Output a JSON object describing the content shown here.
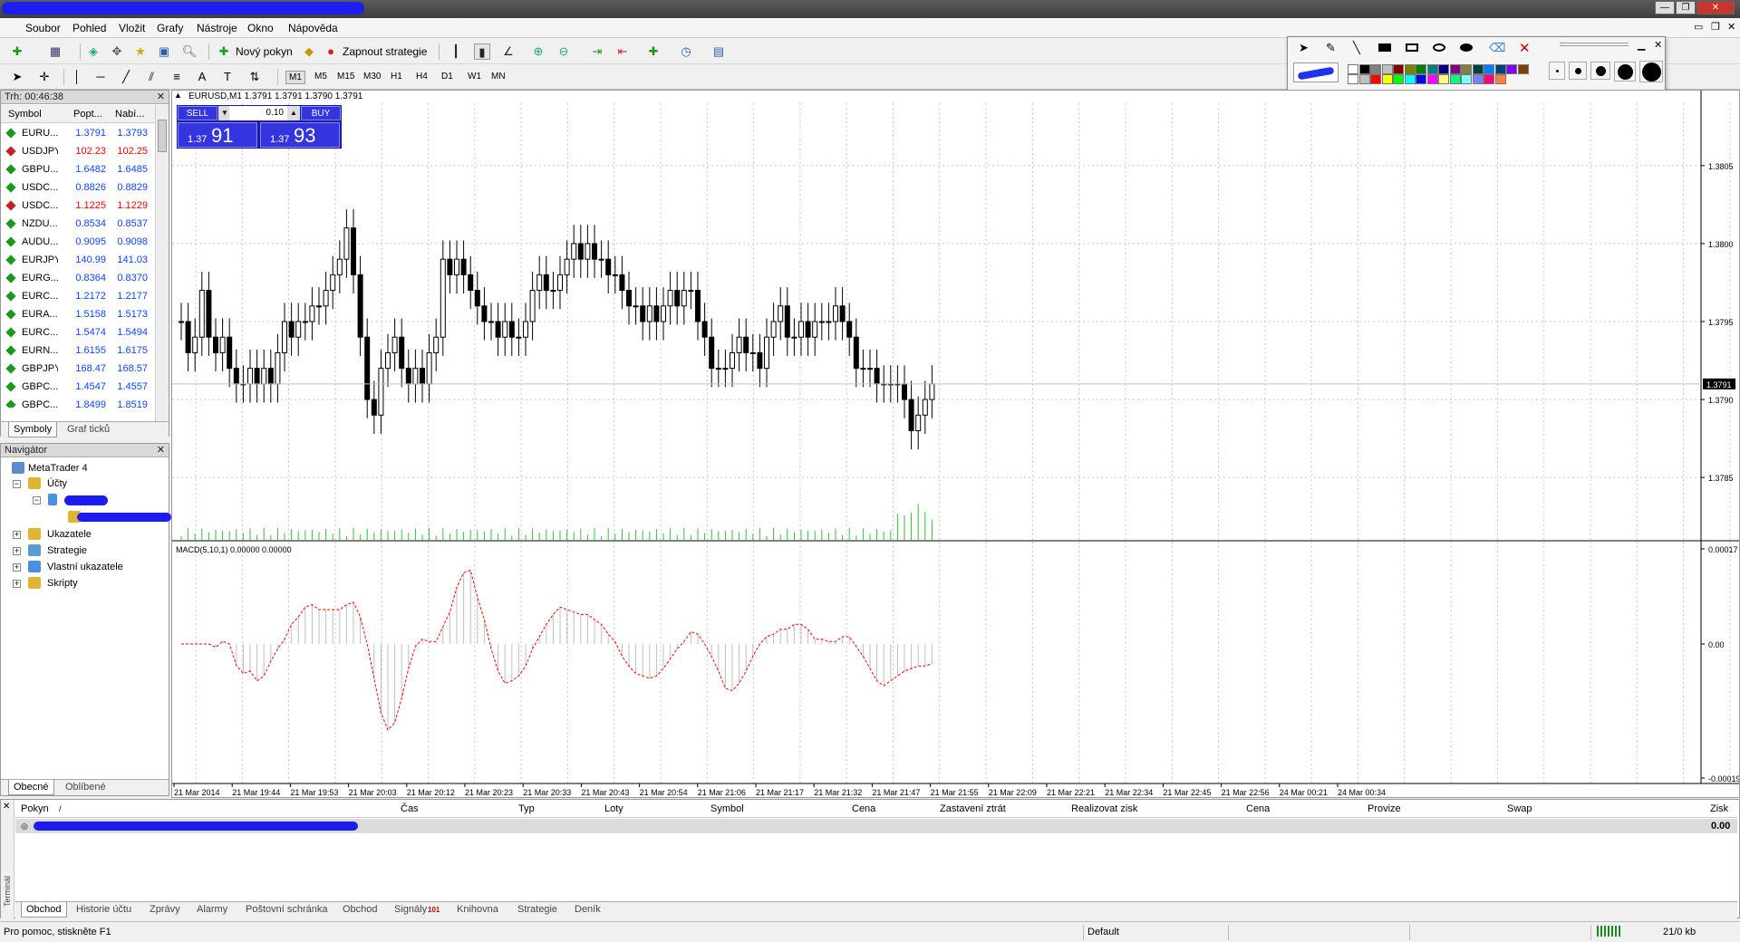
{
  "window": {
    "close_glyph": "✕",
    "restore_glyph": "❐",
    "min_glyph": "—"
  },
  "menu": {
    "items": [
      "Soubor",
      "Pohled",
      "Vložit",
      "Grafy",
      "Nástroje",
      "Okno",
      "Nápověda"
    ]
  },
  "toolbar": {
    "new_order_label": "Nový pokyn",
    "autotrade_label": "Zapnout strategie",
    "timeframes": [
      "M1",
      "M5",
      "M15",
      "M30",
      "H1",
      "H4",
      "D1",
      "W1",
      "MN"
    ],
    "active_timeframe": "M1"
  },
  "palette": {
    "colors": [
      "#ffffff",
      "#000000",
      "#808080",
      "#c0c0c0",
      "#800000",
      "#808000",
      "#008000",
      "#008080",
      "#000080",
      "#800080",
      "#808040",
      "#004040",
      "#0080ff",
      "#004080",
      "#8000ff",
      "#804000",
      "#ffffff",
      "#c0c0c0",
      "#ff0000",
      "#ffff00",
      "#00ff00",
      "#00ffff",
      "#0000ff",
      "#ff00ff",
      "#ffff80",
      "#00ff80",
      "#80ffff",
      "#8080ff",
      "#ff0080",
      "#ff8040"
    ]
  },
  "market_watch": {
    "title": "Trh: 00:46:38",
    "columns": [
      "Symbol",
      "Popt...",
      "Nabí..."
    ],
    "rows": [
      {
        "symbol": "EURU...",
        "bid": "1.3791",
        "ask": "1.3793",
        "dir": "up"
      },
      {
        "symbol": "USDJPY",
        "bid": "102.23",
        "ask": "102.25",
        "dir": "down"
      },
      {
        "symbol": "GBPU...",
        "bid": "1.6482",
        "ask": "1.6485",
        "dir": "up"
      },
      {
        "symbol": "USDC...",
        "bid": "0.8826",
        "ask": "0.8829",
        "dir": "up"
      },
      {
        "symbol": "USDC...",
        "bid": "1.1225",
        "ask": "1.1229",
        "dir": "down"
      },
      {
        "symbol": "NZDU...",
        "bid": "0.8534",
        "ask": "0.8537",
        "dir": "up"
      },
      {
        "symbol": "AUDU...",
        "bid": "0.9095",
        "ask": "0.9098",
        "dir": "up"
      },
      {
        "symbol": "EURJPY",
        "bid": "140.99",
        "ask": "141.03",
        "dir": "up"
      },
      {
        "symbol": "EURG...",
        "bid": "0.8364",
        "ask": "0.8370",
        "dir": "up"
      },
      {
        "symbol": "EURC...",
        "bid": "1.2172",
        "ask": "1.2177",
        "dir": "up"
      },
      {
        "symbol": "EURA...",
        "bid": "1.5158",
        "ask": "1.5173",
        "dir": "up"
      },
      {
        "symbol": "EURC...",
        "bid": "1.5474",
        "ask": "1.5494",
        "dir": "up"
      },
      {
        "symbol": "EURN...",
        "bid": "1.6155",
        "ask": "1.6175",
        "dir": "up"
      },
      {
        "symbol": "GBPJPY",
        "bid": "168.47",
        "ask": "168.57",
        "dir": "up"
      },
      {
        "symbol": "GBPC...",
        "bid": "1.4547",
        "ask": "1.4557",
        "dir": "up"
      },
      {
        "symbol": "GBPC...",
        "bid": "1.8499",
        "ask": "1.8519",
        "dir": "up"
      }
    ],
    "tabs": [
      "Symboly",
      "Graf ticků"
    ]
  },
  "navigator": {
    "title": "Navigátor",
    "root": "MetaTrader 4",
    "accounts": "Účty",
    "items": [
      "Ukazatele",
      "Strategie",
      "Vlastní ukazatele",
      "Skripty"
    ],
    "tabs": [
      "Obecné",
      "Oblíbené"
    ]
  },
  "chart": {
    "header": "EURUSD,M1  1.3791 1.3791 1.3790 1.3791",
    "one_click": {
      "sell": "SELL",
      "buy": "BUY",
      "lot": "0.10",
      "sell_small": "1.37",
      "sell_big": "91",
      "buy_small": "1.37",
      "buy_big": "93"
    },
    "price_ticks": [
      "1.3805",
      "1.3800",
      "1.3795",
      "1.3790",
      "1.3785"
    ],
    "current_price": "1.3791",
    "macd_label": "MACD(5,10,1) 0.00000 0.00000",
    "macd_ticks": [
      "0.00017",
      "0.00",
      "-0.00019"
    ],
    "time_labels": [
      "21 Mar 2014",
      "21 Mar 19:44",
      "21 Mar 19:53",
      "21 Mar 20:03",
      "21 Mar 20:12",
      "21 Mar 20:23",
      "21 Mar 20:33",
      "21 Mar 20:43",
      "21 Mar 20:54",
      "21 Mar 21:06",
      "21 Mar 21:17",
      "21 Mar 21:32",
      "21 Mar 21:47",
      "21 Mar 21:55",
      "21 Mar 22:09",
      "21 Mar 22:21",
      "21 Mar 22:34",
      "21 Mar 22:45",
      "21 Mar 22:56",
      "24 Mar 00:21",
      "24 Mar 00:34"
    ]
  },
  "chart_data": {
    "type": "line",
    "series": [
      {
        "values": [
          1.3795,
          1.3793,
          1.3794,
          1.3797,
          1.3794,
          1.3793,
          1.3794,
          1.3792,
          1.3791,
          1.3791,
          1.3792,
          1.3791,
          1.3792,
          1.3791,
          1.3793,
          1.3795,
          1.3794,
          1.3795,
          1.3795,
          1.3796,
          1.3796,
          1.3797,
          1.3798,
          1.3799,
          1.3801,
          1.3798,
          1.3794,
          1.379,
          1.3789,
          1.3792,
          1.3793,
          1.3794,
          1.3792,
          1.3791,
          1.3792,
          1.3791,
          1.3793,
          1.3794,
          1.3799,
          1.3798,
          1.3799,
          1.3798,
          1.3797,
          1.3796,
          1.3795,
          1.3795,
          1.3794,
          1.3795,
          1.3794,
          1.3794,
          1.3795,
          1.3797,
          1.3798,
          1.3797,
          1.3797,
          1.3798,
          1.3799,
          1.38,
          1.3799,
          1.38,
          1.3799,
          1.3799,
          1.3798,
          1.3798,
          1.3797,
          1.3796,
          1.3796,
          1.3795,
          1.3796,
          1.3795,
          1.3796,
          1.3797,
          1.3796,
          1.3797,
          1.3797,
          1.3795,
          1.3794,
          1.3792,
          1.3792,
          1.3792,
          1.3793,
          1.3794,
          1.3793,
          1.3793,
          1.3792,
          1.3794,
          1.3795,
          1.3796,
          1.3794,
          1.3794,
          1.3795,
          1.3794,
          1.3795,
          1.3795,
          1.3795,
          1.3796,
          1.3795,
          1.3794,
          1.3792,
          1.3792,
          1.3792,
          1.3791,
          1.3791,
          1.3791,
          1.3791,
          1.379,
          1.3788,
          1.3789,
          1.379,
          1.3791
        ],
        "name": "EURUSD"
      }
    ],
    "ylim": [
      1.3781,
      1.3809
    ],
    "grid": true
  },
  "terminal": {
    "side_label": "Terminál",
    "columns": [
      "Pokyn",
      "Čas",
      "Typ",
      "Loty",
      "Symbol",
      "Cena",
      "Zastavení ztrát",
      "Realizovat zisk",
      "Cena",
      "Provize",
      "Swap",
      "Zisk"
    ],
    "balance_value": "0.00",
    "tabs": [
      "Obchod",
      "Historie účtu",
      "Zprávy",
      "Alarmy",
      "Poštovní schránka",
      "Obchod",
      "Signály",
      "Knihovna",
      "Strategie",
      "Deník"
    ],
    "signals_badge": "101"
  },
  "status": {
    "help": "Pro pomoc, stiskněte F1",
    "profile": "Default",
    "traffic": "21/0 kb"
  }
}
